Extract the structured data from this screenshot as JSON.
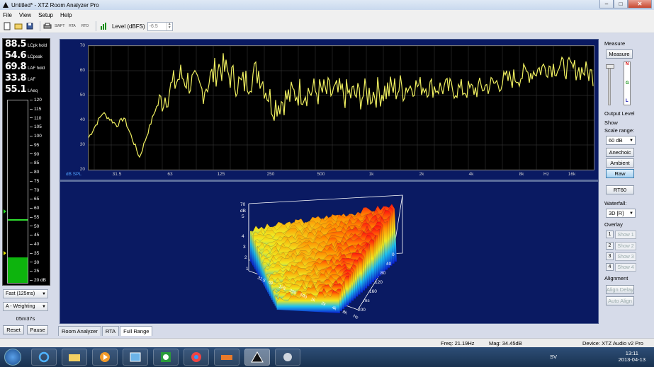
{
  "window": {
    "title": "Untitled* - XTZ Room Analyzer Pro",
    "min": "–",
    "max": "□",
    "close": "✕"
  },
  "menu": [
    "File",
    "View",
    "Setup",
    "Help"
  ],
  "toolbar": {
    "modes": [
      "SWPT",
      "RTA",
      "RTO"
    ],
    "level_label": "Level (dBFS)",
    "level_value": "-6.5"
  },
  "meter": {
    "readouts": [
      {
        "value": "88.5",
        "label": "LCpk hold"
      },
      {
        "value": "54.6",
        "label": "LCpeak"
      },
      {
        "value": "69.8",
        "label": "LAF hold"
      },
      {
        "value": "33.8",
        "label": "LAF"
      },
      {
        "value": "55.1",
        "label": "LAeq"
      }
    ],
    "scale": [
      "120",
      "115",
      "110",
      "105",
      "100",
      "95",
      "90",
      "85",
      "80",
      "75",
      "70",
      "65",
      "60",
      "55",
      "50",
      "45",
      "40",
      "35",
      "30",
      "25",
      "20 dB"
    ],
    "level_fraction": 0.14,
    "hold_fraction": 0.34,
    "speed": "Fast (125ms)",
    "weighting": "A - Weighting",
    "timer": "05m37s",
    "reset_label": "Reset",
    "pause_label": "Pause"
  },
  "fr_graph": {
    "yticks": [
      "70",
      "60",
      "50",
      "40",
      "30",
      "20"
    ],
    "xticks": [
      "31.5",
      "63",
      "125",
      "250",
      "500",
      "1k",
      "2k",
      "4k",
      "8k",
      "Hz",
      "16k"
    ],
    "ylabel": "dB SPL"
  },
  "waterfall": {
    "z_ticks": [
      "70",
      "dB",
      "5",
      "4",
      "3",
      "2",
      "1"
    ],
    "x_ticks": [
      "31.5",
      "63",
      "125",
      "250",
      "500",
      "1k",
      "2k",
      "4k",
      "8k",
      "Hz"
    ],
    "t_ticks": [
      "0",
      "40",
      "80",
      "120",
      "160",
      "ms",
      "200"
    ]
  },
  "right_panel": {
    "measure_title": "Measure",
    "measure_btn": "Measure",
    "meter_letters": [
      "N",
      "G",
      "L"
    ],
    "output_level": "Output Level",
    "show": "Show",
    "scale_range": "Scale range:",
    "scale_value": "60 dB",
    "anechoic": "Anechoic",
    "ambient": "Ambient",
    "raw": "Raw",
    "rt60": "RT60",
    "waterfall_label": "Waterfall:",
    "waterfall_value": "3D [R]",
    "overlay": "Overlay",
    "overlays": [
      {
        "num": "1",
        "label": "Show 1"
      },
      {
        "num": "2",
        "label": "Show 2"
      },
      {
        "num": "3",
        "label": "Show 3"
      },
      {
        "num": "4",
        "label": "Show 4"
      }
    ],
    "alignment": "Alignment",
    "align_delay": "Align Delay",
    "auto_align": "Auto Align"
  },
  "tabs": [
    "Room Analyzer",
    "RTA",
    "Full Range"
  ],
  "status": {
    "freq": "Freq: 21.19Hz",
    "mag": "Mag: 34.45dB",
    "device": "Device: XTZ Audio v2 Pro"
  },
  "taskbar": {
    "lang": "SV",
    "time": "13:11",
    "date": "2013-04-13"
  },
  "colors": {
    "graph_bg": "#0a1a62",
    "trace": "#f0f060",
    "meter_green": "#0db40d"
  }
}
